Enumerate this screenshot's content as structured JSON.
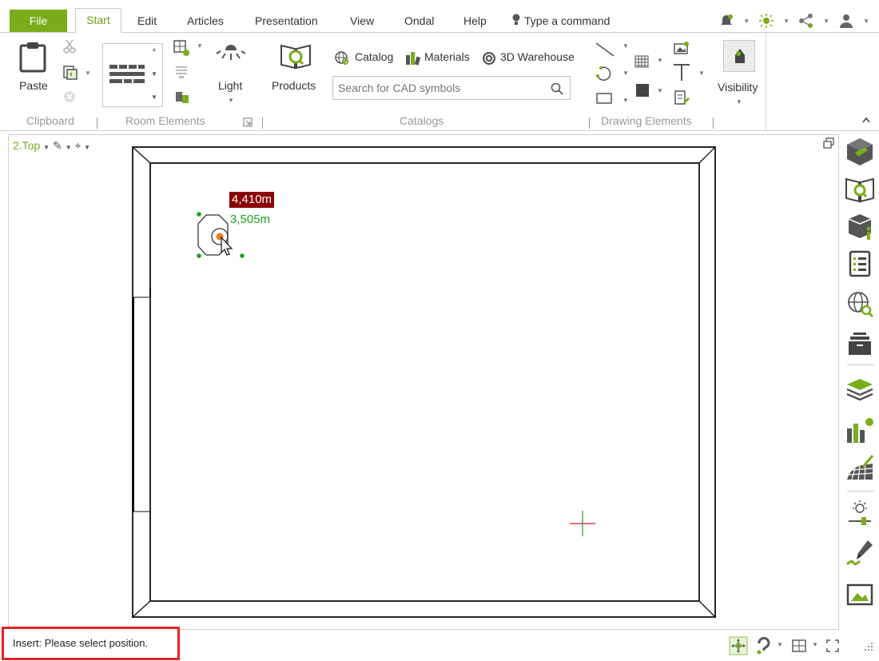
{
  "menu": {
    "tabs": [
      "File",
      "Start",
      "Edit",
      "Articles",
      "Presentation",
      "View",
      "Ondal",
      "Help"
    ],
    "command_placeholder": "Type a command"
  },
  "ribbon": {
    "clipboard": {
      "paste_label": "Paste",
      "group_label": "Clipboard"
    },
    "room_elements": {
      "light_label": "Light",
      "group_label": "Room Elements"
    },
    "catalogs": {
      "products_label": "Products",
      "catalog_label": "Catalog",
      "materials_label": "Materials",
      "warehouse_label": "3D Warehouse",
      "search_placeholder": "Search for CAD symbols",
      "group_label": "Catalogs"
    },
    "drawing_elements": {
      "group_label": "Drawing Elements"
    },
    "visibility_label": "Visibility"
  },
  "view": {
    "label": "2.Top",
    "dim_x": "4,410m",
    "dim_y": "3,505m"
  },
  "status": {
    "text": "Insert: Please select position."
  },
  "colors": {
    "accent_green": "#79ad1b",
    "dim_red": "#8b0000",
    "dim_green": "#1aa31a",
    "highlight_red": "#e52421",
    "cursor_orange": "#f07d19"
  }
}
